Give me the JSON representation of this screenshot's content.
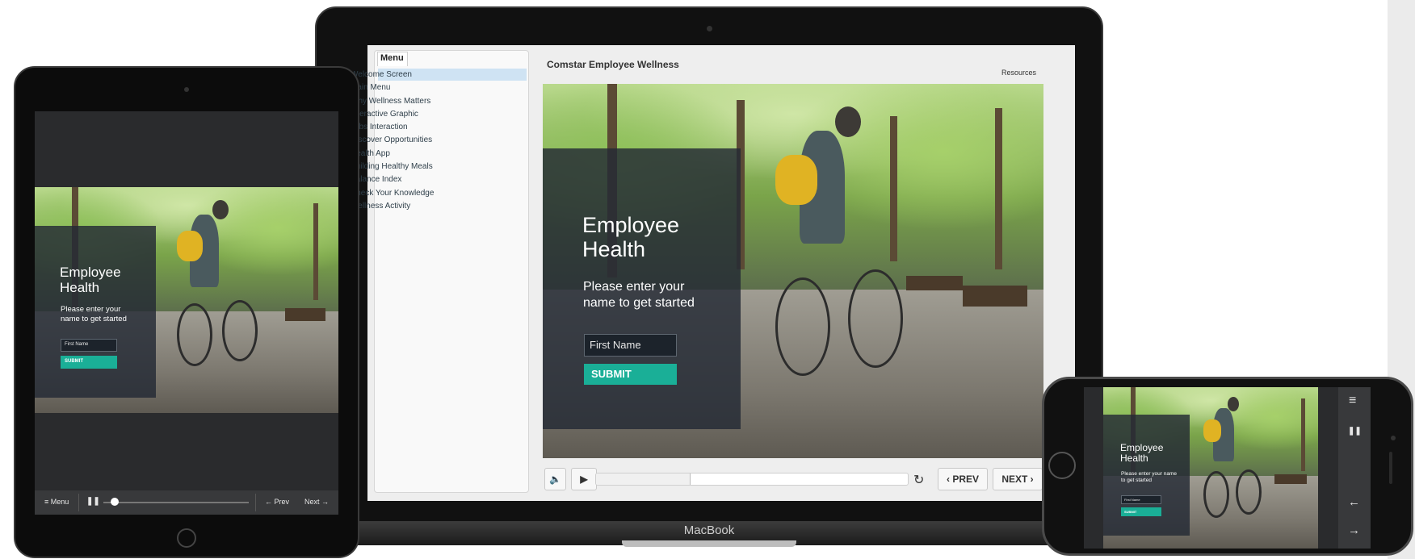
{
  "laptop": {
    "brand": "MacBook",
    "menu": {
      "title": "Menu",
      "items": [
        {
          "label": "Welcome Screen",
          "selected": true
        },
        {
          "label": "Main Menu"
        },
        {
          "label": "Why Wellness Matters"
        },
        {
          "label": "Interactive Graphic"
        },
        {
          "label": "Tabs Interaction"
        },
        {
          "label": "Discover Opportunities"
        },
        {
          "label": "Health App"
        },
        {
          "label": "Building Healthy Meals"
        },
        {
          "label": "Balance Index"
        },
        {
          "label": "Check Your Knowledge"
        },
        {
          "label": "Wellness Activity"
        }
      ]
    },
    "course_title": "Comstar Employee Wellness",
    "resources_label": "Resources",
    "slide": {
      "title": "Employee Health",
      "subtitle": "Please enter your name to get started",
      "input_placeholder": "First Name",
      "submit_label": "SUBMIT"
    },
    "player": {
      "prev_label": "‹ PREV",
      "next_label": "NEXT ›",
      "progress": 0.3
    }
  },
  "tablet": {
    "slide": {
      "title": "Employee Health",
      "subtitle": "Please enter your name to get started",
      "input_placeholder": "First Name",
      "submit_label": "SUBMIT"
    },
    "controls": {
      "menu_label": "≡ Menu",
      "prev_label": "← Prev",
      "next_label": "Next →",
      "progress": 0.05
    }
  },
  "phone": {
    "slide": {
      "title": "Employee Health",
      "subtitle": "Please enter your name to get started",
      "input_placeholder": "First Name",
      "submit_label": "SUBMIT"
    },
    "side_controls": {
      "menu_icon": "≡",
      "pause_icon": "❚❚",
      "prev_icon": "←",
      "next_icon": "→"
    }
  },
  "colors": {
    "accent": "#1aaf97",
    "overlay": "#232a34",
    "menu_selected": "#cfe3f3"
  }
}
